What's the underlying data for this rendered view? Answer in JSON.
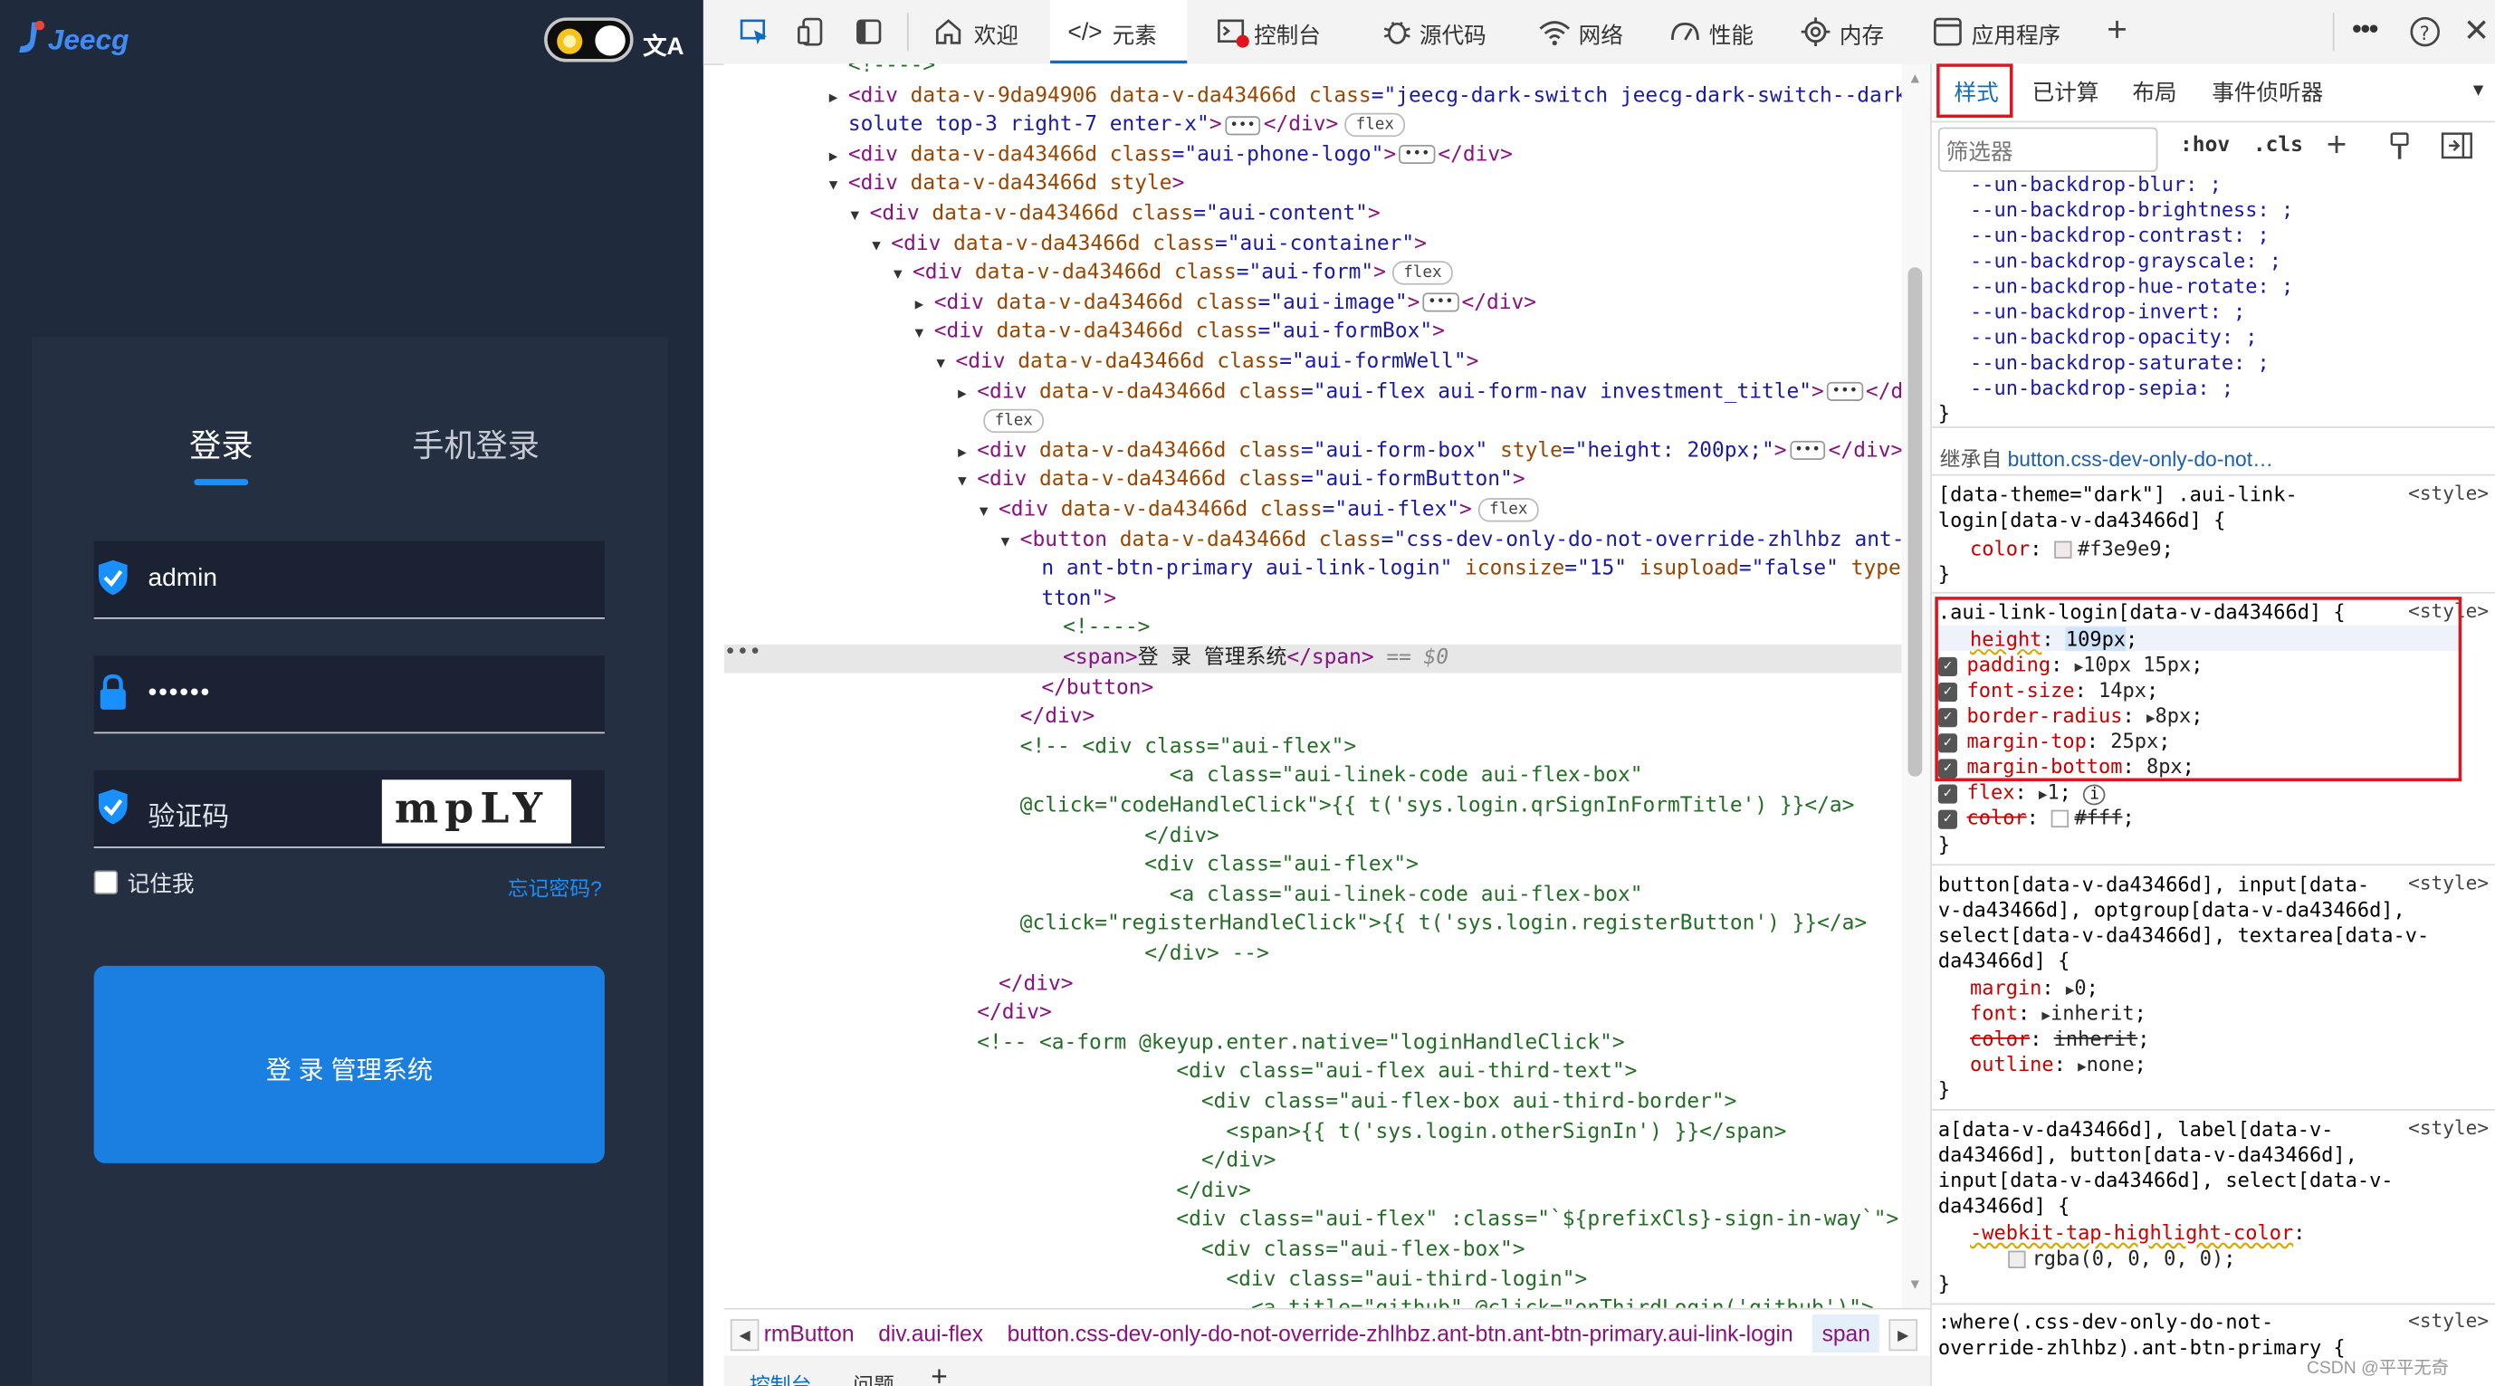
{
  "app": {
    "logo_text": "Jeecg",
    "tabs": {
      "login": "登录",
      "phone": "手机登录"
    },
    "username": "admin",
    "password_mask": "••••••",
    "captcha_placeholder": "验证码",
    "captcha_text": "mpLY",
    "remember_label": "记住我",
    "forgot_label": "忘记密码?",
    "login_button": "登 录 管理系统"
  },
  "toolbar": {
    "tabs": [
      "欢迎",
      "元素",
      "控制台",
      "源代码",
      "网络",
      "性能",
      "内存",
      "应用程序"
    ],
    "active_tab": "元素"
  },
  "elements": {
    "lines": [
      {
        "d": 0,
        "t": "",
        "h": "<span class='cm'>&lt;!----&gt;</span>"
      },
      {
        "d": 0,
        "t": "▶",
        "h": "<span class='tg'>&lt;div</span> <span class='at'>data-v-9da94906</span> <span class='at'>data-v-da43466d</span> <span class='at'>class</span>=<span class='av'>\"jeecg-dark-switch jeecg-dark-switch--dark ab</span>"
      },
      {
        "d": 0,
        "t": "",
        "h": "<span class='av'>solute top-3 right-7 enter-x\"</span><span class='tg'>&gt;</span><span class='ell'>•••</span><span class='tg'>&lt;/div&gt;</span><span class='pill'>flex</span>"
      },
      {
        "d": 0,
        "t": "▶",
        "h": "<span class='tg'>&lt;div</span> <span class='at'>data-v-da43466d</span> <span class='at'>class</span>=<span class='av'>\"aui-phone-logo\"</span><span class='tg'>&gt;</span><span class='ell'>•••</span><span class='tg'>&lt;/div&gt;</span>"
      },
      {
        "d": 0,
        "t": "▼",
        "h": "<span class='tg'>&lt;div</span> <span class='at'>data-v-da43466d</span> <span class='at'>style</span><span class='tg'>&gt;</span>"
      },
      {
        "d": 1,
        "t": "▼",
        "h": "<span class='tg'>&lt;div</span> <span class='at'>data-v-da43466d</span> <span class='at'>class</span>=<span class='av'>\"aui-content\"</span><span class='tg'>&gt;</span>"
      },
      {
        "d": 2,
        "t": "▼",
        "h": "<span class='tg'>&lt;div</span> <span class='at'>data-v-da43466d</span> <span class='at'>class</span>=<span class='av'>\"aui-container\"</span><span class='tg'>&gt;</span>"
      },
      {
        "d": 3,
        "t": "▼",
        "h": "<span class='tg'>&lt;div</span> <span class='at'>data-v-da43466d</span> <span class='at'>class</span>=<span class='av'>\"aui-form\"</span><span class='tg'>&gt;</span><span class='pill'>flex</span>"
      },
      {
        "d": 4,
        "t": "▶",
        "h": "<span class='tg'>&lt;div</span> <span class='at'>data-v-da43466d</span> <span class='at'>class</span>=<span class='av'>\"aui-image\"</span><span class='tg'>&gt;</span><span class='ell'>•••</span><span class='tg'>&lt;/div&gt;</span>"
      },
      {
        "d": 4,
        "t": "▼",
        "h": "<span class='tg'>&lt;div</span> <span class='at'>data-v-da43466d</span> <span class='at'>class</span>=<span class='av'>\"aui-formBox\"</span><span class='tg'>&gt;</span>"
      },
      {
        "d": 5,
        "t": "▼",
        "h": "<span class='tg'>&lt;div</span> <span class='at'>data-v-da43466d</span> <span class='at'>class</span>=<span class='av'>\"aui-formWell\"</span><span class='tg'>&gt;</span>"
      },
      {
        "d": 6,
        "t": "▶",
        "h": "<span class='tg'>&lt;div</span> <span class='at'>data-v-da43466d</span> <span class='at'>class</span>=<span class='av'>\"aui-flex aui-form-nav investment_title\"</span><span class='tg'>&gt;</span><span class='ell'>•••</span><span class='tg'>&lt;/div&gt;</span>"
      },
      {
        "d": 6,
        "t": "",
        "h": "<span class='pill'>flex</span>"
      },
      {
        "d": 6,
        "t": "▶",
        "h": "<span class='tg'>&lt;div</span> <span class='at'>data-v-da43466d</span> <span class='at'>class</span>=<span class='av'>\"aui-form-box\"</span> <span class='at'>style</span>=<span class='av'>\"height: 200px;\"</span><span class='tg'>&gt;</span><span class='ell'>•••</span><span class='tg'>&lt;/div&gt;</span>"
      },
      {
        "d": 6,
        "t": "▼",
        "h": "<span class='tg'>&lt;div</span> <span class='at'>data-v-da43466d</span> <span class='at'>class</span>=<span class='av'>\"aui-formButton\"</span><span class='tg'>&gt;</span>"
      },
      {
        "d": 7,
        "t": "▼",
        "h": "<span class='tg'>&lt;div</span> <span class='at'>data-v-da43466d</span> <span class='at'>class</span>=<span class='av'>\"aui-flex\"</span><span class='tg'>&gt;</span><span class='pill'>flex</span>"
      },
      {
        "d": 8,
        "t": "▼",
        "h": "<span class='tg'>&lt;button</span> <span class='at'>data-v-da43466d</span> <span class='at'>class</span>=<span class='av'>\"css-dev-only-do-not-override-zhlhbz ant-bt</span>"
      },
      {
        "d": 9,
        "t": "",
        "h": "<span class='av'>n ant-btn-primary aui-link-login\"</span> <span class='at'>iconsize</span>=<span class='av'>\"15\"</span> <span class='at'>isupload</span>=<span class='av'>\"false\"</span> <span class='at'>type</span>=<span class='av'>\"bu</span>"
      },
      {
        "d": 9,
        "t": "",
        "h": "<span class='av'>tton\"</span><span class='tg'>&gt;</span>"
      },
      {
        "d": 10,
        "t": "",
        "h": "<span class='cm'>&lt;!----&gt;</span>"
      },
      {
        "d": 10,
        "t": "",
        "sel": true,
        "h": "<span class='tg'>&lt;span&gt;</span><span class='tx'>登 录 管理系统</span><span class='tg'>&lt;/span&gt;</span> <span class='dollar'>== $0</span>"
      },
      {
        "d": 9,
        "t": "",
        "h": "<span class='tg'>&lt;/button&gt;</span>"
      },
      {
        "d": 8,
        "t": "",
        "h": "<span class='tg'>&lt;/div&gt;</span>"
      },
      {
        "d": 8,
        "t": "",
        "h": "<span class='cm'>&lt;!-- &lt;div class=\"aui-flex\"&gt;</span>"
      },
      {
        "d": 8,
        "t": "",
        "h": "<span class='cm'>&#160;&#160;&#160;&#160;&#160;&#160;&#160;&#160;&#160;&#160;&#160;&#160;&lt;a class=\"aui-linek-code aui-flex-box\"</span>"
      },
      {
        "d": 8,
        "t": "",
        "h": "<span class='cm'>@click=\"codeHandleClick\"&gt;{{ t('sys.login.qrSignInFormTitle') }}&lt;/a&gt;</span>"
      },
      {
        "d": 8,
        "t": "",
        "h": "<span class='cm'>&#160;&#160;&#160;&#160;&#160;&#160;&#160;&#160;&#160;&#160;&lt;/div&gt;</span>"
      },
      {
        "d": 8,
        "t": "",
        "h": "<span class='cm'>&#160;&#160;&#160;&#160;&#160;&#160;&#160;&#160;&#160;&#160;&lt;div class=\"aui-flex\"&gt;</span>"
      },
      {
        "d": 8,
        "t": "",
        "h": "<span class='cm'>&#160;&#160;&#160;&#160;&#160;&#160;&#160;&#160;&#160;&#160;&#160;&#160;&lt;a class=\"aui-linek-code aui-flex-box\"</span>"
      },
      {
        "d": 8,
        "t": "",
        "h": "<span class='cm'>@click=\"registerHandleClick\"&gt;{{ t('sys.login.registerButton') }}&lt;/a&gt;</span>"
      },
      {
        "d": 8,
        "t": "",
        "h": "<span class='cm'>&#160;&#160;&#160;&#160;&#160;&#160;&#160;&#160;&#160;&#160;&lt;/div&gt; --&gt;</span>"
      },
      {
        "d": 7,
        "t": "",
        "h": "<span class='tg'>&lt;/div&gt;</span>"
      },
      {
        "d": 6,
        "t": "",
        "h": "<span class='tg'>&lt;/div&gt;</span>"
      },
      {
        "d": 6,
        "t": "",
        "h": "<span class='cm'>&lt;!-- &lt;a-form @keyup.enter.native=\"loginHandleClick\"&gt;</span>"
      },
      {
        "d": 6,
        "t": "",
        "h": "<span class='cm'>&#160;&#160;&#160;&#160;&#160;&#160;&#160;&#160;&#160;&#160;&#160;&#160;&#160;&#160;&#160;&#160;&lt;div class=\"aui-flex aui-third-text\"&gt;</span>"
      },
      {
        "d": 6,
        "t": "",
        "h": "<span class='cm'>&#160;&#160;&#160;&#160;&#160;&#160;&#160;&#160;&#160;&#160;&#160;&#160;&#160;&#160;&#160;&#160;&#160;&#160;&lt;div class=\"aui-flex-box aui-third-border\"&gt;</span>"
      },
      {
        "d": 6,
        "t": "",
        "h": "<span class='cm'>&#160;&#160;&#160;&#160;&#160;&#160;&#160;&#160;&#160;&#160;&#160;&#160;&#160;&#160;&#160;&#160;&#160;&#160;&#160;&#160;&lt;span&gt;{{ t('sys.login.otherSignIn') }}&lt;/span&gt;</span>"
      },
      {
        "d": 6,
        "t": "",
        "h": "<span class='cm'>&#160;&#160;&#160;&#160;&#160;&#160;&#160;&#160;&#160;&#160;&#160;&#160;&#160;&#160;&#160;&#160;&#160;&#160;&lt;/div&gt;</span>"
      },
      {
        "d": 6,
        "t": "",
        "h": "<span class='cm'>&#160;&#160;&#160;&#160;&#160;&#160;&#160;&#160;&#160;&#160;&#160;&#160;&#160;&#160;&#160;&#160;&lt;/div&gt;</span>"
      },
      {
        "d": 6,
        "t": "",
        "h": "<span class='cm'>&#160;&#160;&#160;&#160;&#160;&#160;&#160;&#160;&#160;&#160;&#160;&#160;&#160;&#160;&#160;&#160;&lt;div class=\"aui-flex\" :class=\"`${prefixCls}-sign-in-way`\"&gt;</span>"
      },
      {
        "d": 6,
        "t": "",
        "h": "<span class='cm'>&#160;&#160;&#160;&#160;&#160;&#160;&#160;&#160;&#160;&#160;&#160;&#160;&#160;&#160;&#160;&#160;&#160;&#160;&lt;div class=\"aui-flex-box\"&gt;</span>"
      },
      {
        "d": 6,
        "t": "",
        "h": "<span class='cm'>&#160;&#160;&#160;&#160;&#160;&#160;&#160;&#160;&#160;&#160;&#160;&#160;&#160;&#160;&#160;&#160;&#160;&#160;&#160;&#160;&lt;div class=\"aui-third-login\"&gt;</span>"
      },
      {
        "d": 6,
        "t": "",
        "h": "<span class='cm'>&#160;&#160;&#160;&#160;&#160;&#160;&#160;&#160;&#160;&#160;&#160;&#160;&#160;&#160;&#160;&#160;&#160;&#160;&#160;&#160;&#160;&#160;&lt;a title=\"github\" @click=\"onThirdLogin('github')\"&gt;</span>"
      }
    ]
  },
  "breadcrumb": {
    "items": [
      "rmButton",
      "div.aui-flex",
      "button.css-dev-only-do-not-override-zhlhbz.ant-btn.ant-btn-primary.aui-link-login",
      "span"
    ]
  },
  "bottom_tabs": [
    "控制台",
    "问题"
  ],
  "styles": {
    "tabs": [
      "样式",
      "已计算",
      "布局",
      "事件侦听器"
    ],
    "filter_placeholder": "筛选器",
    "hov": ":hov",
    "cls": ".cls",
    "backdrop_props": [
      "--un-backdrop-blur: ;",
      "--un-backdrop-brightness: ;",
      "--un-backdrop-contrast: ;",
      "--un-backdrop-grayscale: ;",
      "--un-backdrop-hue-rotate: ;",
      "--un-backdrop-invert: ;",
      "--un-backdrop-opacity: ;",
      "--un-backdrop-saturate: ;",
      "--un-backdrop-sepia: ;"
    ],
    "inherited_label": "继承自",
    "inherited_from": "button.css-dev-only-do-not…",
    "style_tag": "<style>",
    "watermark": "CSDN @平平无奇",
    "highlight_color": "#e0141e",
    "accent_color": "#1890ff",
    "rule_dark": {
      "selector_1": "[data-theme=\"dark\"] .aui-link-",
      "selector_2": "login[data-v-da43466d] {",
      "prop": "color",
      "value": "#f3e9e9"
    },
    "rule_main": {
      "selector": ".aui-link-login[data-v-da43466d] {",
      "height_value": "109px",
      "props": [
        {
          "n": "padding",
          "v": "10px 15px",
          "arrow": true
        },
        {
          "n": "font-size",
          "v": "14px"
        },
        {
          "n": "border-radius",
          "v": "8px",
          "arrow": true
        },
        {
          "n": "margin-top",
          "v": "25px"
        },
        {
          "n": "margin-bottom",
          "v": "8px"
        },
        {
          "n": "flex",
          "v": "1",
          "arrow": true,
          "info": true
        },
        {
          "n": "color",
          "v": "#fff",
          "strike": true,
          "swatch": true
        }
      ]
    },
    "rule_button": {
      "selector": [
        "button[data-v-da43466d], input[data-",
        "v-da43466d], optgroup[data-v-da43466d],",
        "select[data-v-da43466d], textarea[data-v-",
        "da43466d] {"
      ],
      "props": [
        {
          "n": "margin",
          "v": "0",
          "arrow": true
        },
        {
          "n": "font",
          "v": "inherit",
          "arrow": true
        },
        {
          "n": "color",
          "v": "inherit",
          "strike": true
        },
        {
          "n": "outline",
          "v": "none",
          "arrow": true
        }
      ]
    },
    "rule_tap": {
      "selector": [
        "a[data-v-da43466d], label[data-v-",
        "da43466d], button[data-v-da43466d],",
        "input[data-v-da43466d], select[data-v-",
        "da43466d] {"
      ],
      "prop": "-webkit-tap-highlight-color",
      "value": "rgba(0, 0, 0, 0)"
    },
    "rule_where": [
      ":where(.css-dev-only-do-not-",
      "override-zhlhbz).ant-btn-primary {"
    ]
  }
}
